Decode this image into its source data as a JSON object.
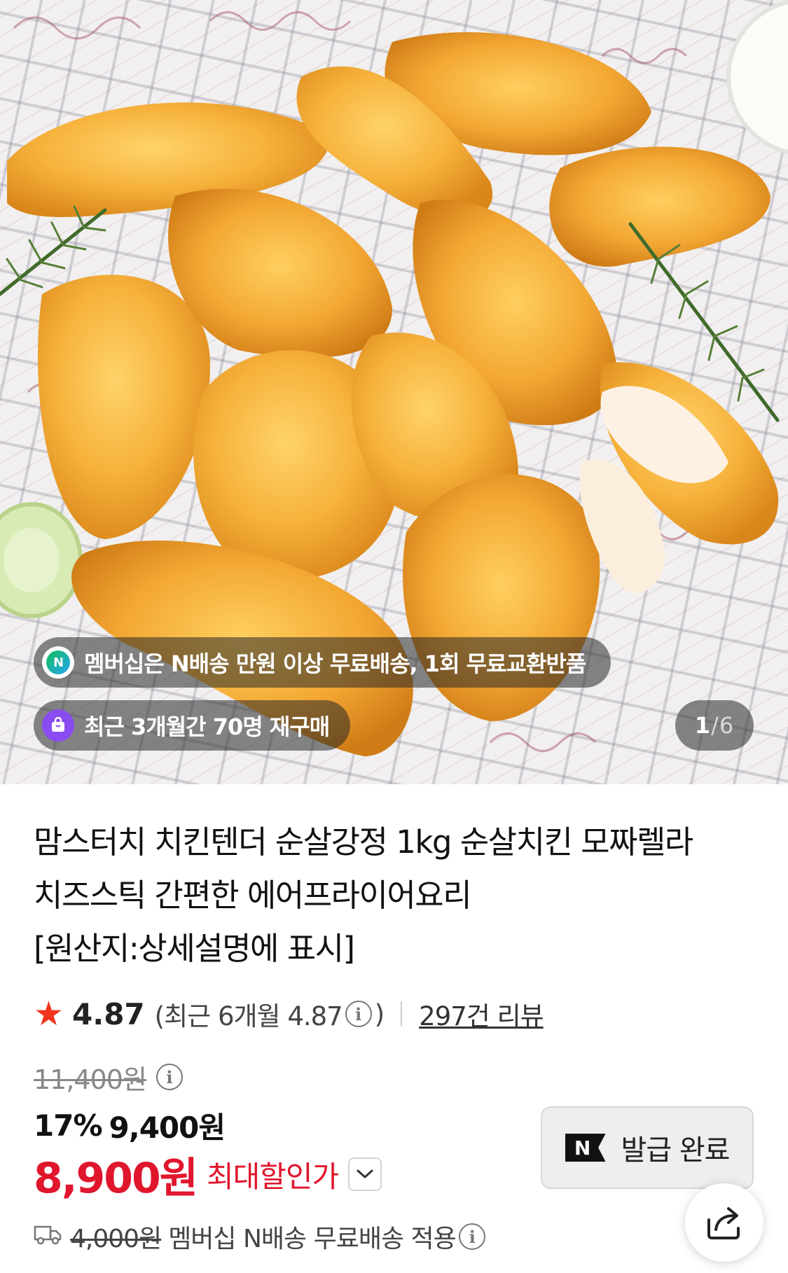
{
  "hero": {
    "membership_badge_icon": "n-delivery-icon",
    "membership_text": "멤버십은 N배송 만원 이상 무료배송, 1회 무료교환반품",
    "repurchase_badge_icon": "shopping-bag-icon",
    "repurchase_text": "최근 3개월간 70명 재구매",
    "image_counter": {
      "current": "1",
      "separator": "/",
      "total": "6"
    }
  },
  "product": {
    "title_lines": [
      "맘스터치 치킨텐더 순살강정 1kg 순살치킨 모짜렐라",
      "치즈스틱 간편한 에어프라이어요리",
      "[원산지:상세설명에 표시]"
    ]
  },
  "rating": {
    "star_icon": "star-icon",
    "star_color": "#f0351f",
    "score": "4.87",
    "recent_prefix": "(최근 6개월 4.87",
    "recent_suffix": ")",
    "info_glyph": "i",
    "reviews_link": "297건 리뷰"
  },
  "price": {
    "original": "11,400원",
    "discount_percent": "17%",
    "sale_price": "9,400원",
    "max_discount_price": "8,900원",
    "max_discount_label": "최대할인가",
    "accent_color": "#e0162d"
  },
  "coupon": {
    "logo_letter": "N",
    "label": "발급 완료"
  },
  "shipping": {
    "icon": "truck-icon",
    "original_fee": "4,000원",
    "text": "멤버십 N배송 무료배송 적용"
  },
  "share": {
    "icon": "share-icon"
  }
}
